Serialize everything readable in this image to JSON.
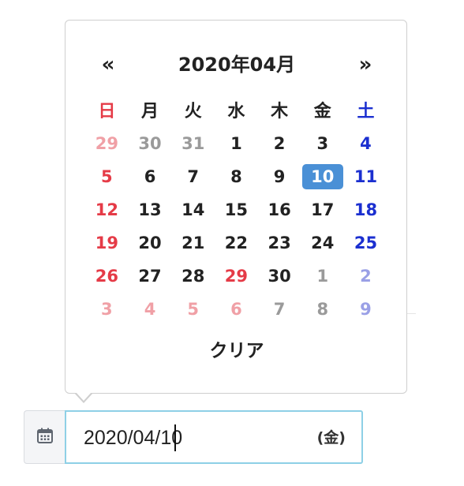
{
  "calendar": {
    "prev_label": "«",
    "next_label": "»",
    "title": "2020年04月",
    "weekdays": [
      "日",
      "月",
      "火",
      "水",
      "木",
      "金",
      "土"
    ],
    "weeks": [
      [
        "29",
        "30",
        "31",
        "1",
        "2",
        "3",
        "4"
      ],
      [
        "5",
        "6",
        "7",
        "8",
        "9",
        "10",
        "11"
      ],
      [
        "12",
        "13",
        "14",
        "15",
        "16",
        "17",
        "18"
      ],
      [
        "19",
        "20",
        "21",
        "22",
        "23",
        "24",
        "25"
      ],
      [
        "26",
        "27",
        "28",
        "29",
        "30",
        "1",
        "2"
      ],
      [
        "3",
        "4",
        "5",
        "6",
        "7",
        "8",
        "9"
      ]
    ],
    "selected_day": "10",
    "clear_label": "クリア"
  },
  "input": {
    "calendar_icon": "calendar-icon",
    "value": "2020/04/10",
    "weekday_suffix": "(金)"
  },
  "colors": {
    "sunday": "#e53b47",
    "saturday": "#1b2fd0",
    "selected_bg": "#4a90d6",
    "input_border": "#8ed0e6",
    "muted": "#9a9a9a"
  }
}
